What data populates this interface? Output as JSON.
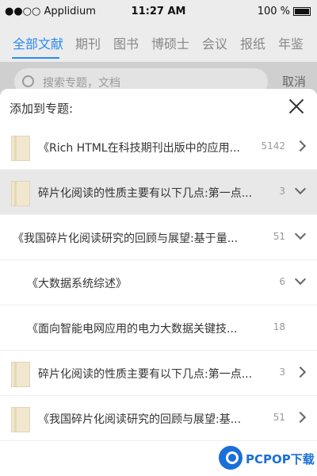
{
  "status": {
    "carrier": "●●○○ Applidium",
    "time": "11:27 AM",
    "battery": "100 %"
  },
  "tabs": [
    "全部文献",
    "期刊",
    "图书",
    "博硕士",
    "会议",
    "报纸",
    "年鉴"
  ],
  "active_tab": 0,
  "search": {
    "placeholder": "搜索专题，文档",
    "cancel": "取消"
  },
  "sheet": {
    "title": "添加到专题:",
    "rows": [
      {
        "label": "《Rich HTML在科技期刊出版中的应用...",
        "count": "5142",
        "icon": true,
        "chevron": "right"
      },
      {
        "label": "碎片化阅读的性质主要有以下几点:第一点...",
        "count": "3",
        "icon": true,
        "chevron": "down"
      },
      {
        "label": "《我国碎片化阅读研究的回顾与展望:基于量...",
        "count": "51",
        "icon": false,
        "chevron": "down"
      },
      {
        "label": "《大数据系统综述》",
        "count": "6",
        "icon": false,
        "chevron": "down"
      },
      {
        "label": "《面向智能电网应用的电力大数据关键技...",
        "count": "18",
        "icon": false,
        "chevron": "none"
      },
      {
        "label": "碎片化阅读的性质主要有以下几点:第一点...",
        "count": "3",
        "icon": true,
        "chevron": "right"
      },
      {
        "label": "《我国碎片化阅读研究的回顾与展望:基...",
        "count": "51",
        "icon": true,
        "chevron": "right"
      }
    ]
  },
  "watermark": {
    "text": "PCPOP下载"
  },
  "colors": {
    "accent": "#2d8cf0",
    "watermark": "#1a6fd8"
  }
}
